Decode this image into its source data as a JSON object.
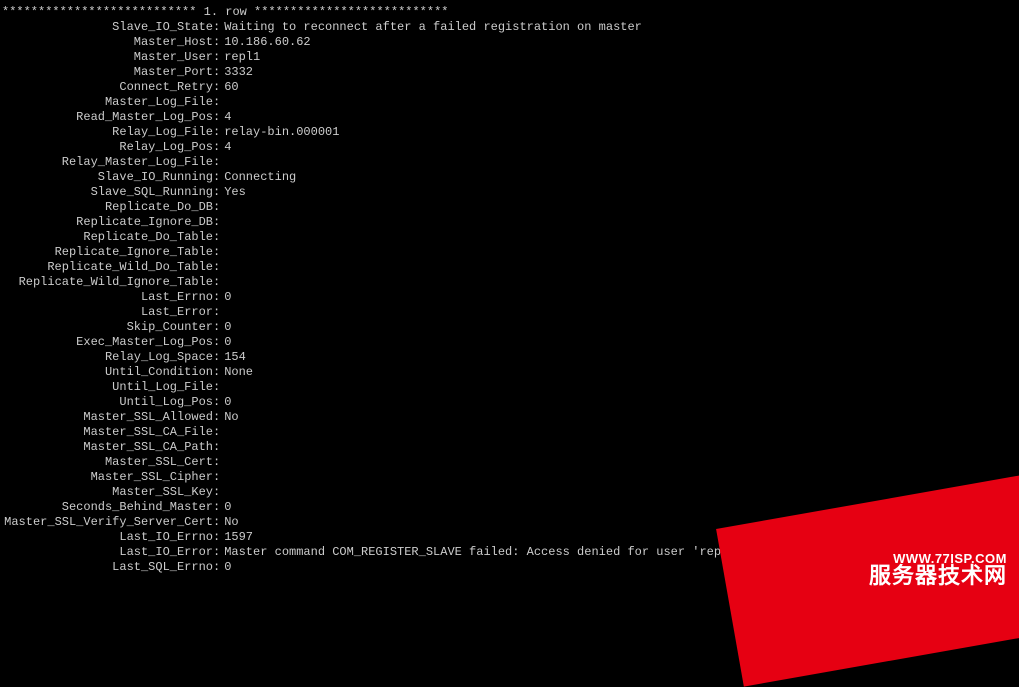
{
  "header": "*************************** 1. row ***************************",
  "fields": [
    {
      "label": "Slave_IO_State",
      "value": "Waiting to reconnect after a failed registration on master"
    },
    {
      "label": "Master_Host",
      "value": "10.186.60.62"
    },
    {
      "label": "Master_User",
      "value": "repl1"
    },
    {
      "label": "Master_Port",
      "value": "3332"
    },
    {
      "label": "Connect_Retry",
      "value": "60"
    },
    {
      "label": "Master_Log_File",
      "value": ""
    },
    {
      "label": "Read_Master_Log_Pos",
      "value": "4"
    },
    {
      "label": "Relay_Log_File",
      "value": "relay-bin.000001"
    },
    {
      "label": "Relay_Log_Pos",
      "value": "4"
    },
    {
      "label": "Relay_Master_Log_File",
      "value": ""
    },
    {
      "label": "Slave_IO_Running",
      "value": "Connecting"
    },
    {
      "label": "Slave_SQL_Running",
      "value": "Yes"
    },
    {
      "label": "Replicate_Do_DB",
      "value": ""
    },
    {
      "label": "Replicate_Ignore_DB",
      "value": ""
    },
    {
      "label": "Replicate_Do_Table",
      "value": ""
    },
    {
      "label": "Replicate_Ignore_Table",
      "value": ""
    },
    {
      "label": "Replicate_Wild_Do_Table",
      "value": ""
    },
    {
      "label": "Replicate_Wild_Ignore_Table",
      "value": ""
    },
    {
      "label": "Last_Errno",
      "value": "0"
    },
    {
      "label": "Last_Error",
      "value": ""
    },
    {
      "label": "Skip_Counter",
      "value": "0"
    },
    {
      "label": "Exec_Master_Log_Pos",
      "value": "0"
    },
    {
      "label": "Relay_Log_Space",
      "value": "154"
    },
    {
      "label": "Until_Condition",
      "value": "None"
    },
    {
      "label": "Until_Log_File",
      "value": ""
    },
    {
      "label": "Until_Log_Pos",
      "value": "0"
    },
    {
      "label": "Master_SSL_Allowed",
      "value": "No"
    },
    {
      "label": "Master_SSL_CA_File",
      "value": ""
    },
    {
      "label": "Master_SSL_CA_Path",
      "value": ""
    },
    {
      "label": "Master_SSL_Cert",
      "value": ""
    },
    {
      "label": "Master_SSL_Cipher",
      "value": ""
    },
    {
      "label": "Master_SSL_Key",
      "value": ""
    },
    {
      "label": "Seconds_Behind_Master",
      "value": "0"
    },
    {
      "label": "Master_SSL_Verify_Server_Cert",
      "value": "No"
    },
    {
      "label": "Last_IO_Errno",
      "value": "1597"
    },
    {
      "label": "Last_IO_Error",
      "value": "Master command COM_REGISTER_SLAVE failed: Access denied for user 'repl1'@'%' (using password"
    },
    {
      "label": "Last_SQL_Errno",
      "value": "0"
    }
  ],
  "watermark": {
    "url": "WWW.77ISP.COM",
    "text": "服务器技术网"
  }
}
